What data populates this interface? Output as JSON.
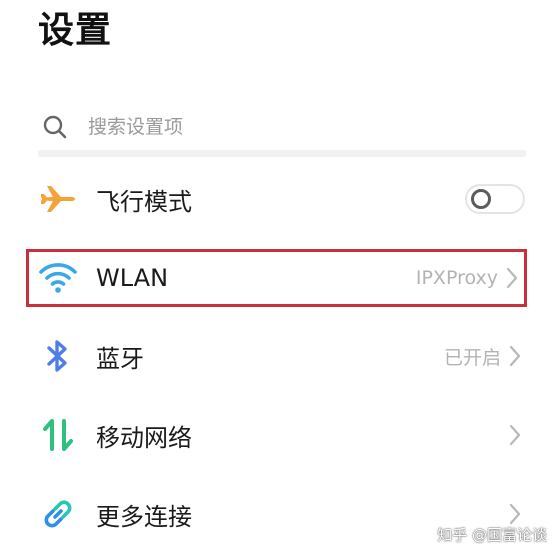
{
  "header": {
    "title": "设置"
  },
  "search": {
    "placeholder": "搜索设置项",
    "icon": "search-icon"
  },
  "rows": [
    {
      "id": "airplane",
      "label": "飞行模式",
      "icon": "airplane-icon",
      "icon_color": "#f4a23a",
      "control": "toggle",
      "toggle_on": false
    },
    {
      "id": "wlan",
      "label": "WLAN",
      "icon": "wifi-icon",
      "icon_color": "#3aa7e8",
      "value": "IPXProxy",
      "control": "chevron",
      "highlighted": true,
      "highlight_color": "#c8303a"
    },
    {
      "id": "bluetooth",
      "label": "蓝牙",
      "icon": "bluetooth-icon",
      "icon_color": "#4f7ee8",
      "value": "已开启",
      "control": "chevron"
    },
    {
      "id": "mobile-network",
      "label": "移动网络",
      "icon": "mobile-data-icon",
      "icon_color": "#2fbf7f",
      "value": "",
      "control": "chevron"
    },
    {
      "id": "more-connections",
      "label": "更多连接",
      "icon": "link-icon",
      "icon_color": "#2f8ee8",
      "value": "",
      "control": "chevron"
    }
  ],
  "watermark": {
    "text": "知乎 @国富论谈"
  }
}
